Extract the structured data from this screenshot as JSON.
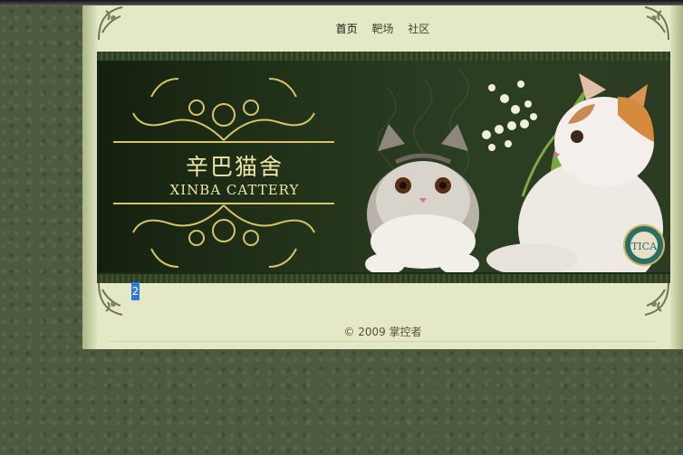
{
  "nav": {
    "items": [
      {
        "label": "首页",
        "active": true
      },
      {
        "label": "靶场",
        "active": false
      },
      {
        "label": "社区",
        "active": false
      }
    ]
  },
  "banner": {
    "title_cn": "辛巴猫舍",
    "title_en": "XINBA CATTERY",
    "badge_icon": "tica-emblem-icon"
  },
  "pagination": {
    "marker": "2"
  },
  "footer": {
    "copyright": "© 2009 掌控者"
  },
  "colors": {
    "page_bg": "#4d5a40",
    "content_bg": "#e4e8c6",
    "banner_bg": "#22331a",
    "logo_gold": "#f0e7a5",
    "marker_blue": "#2e78dc"
  }
}
